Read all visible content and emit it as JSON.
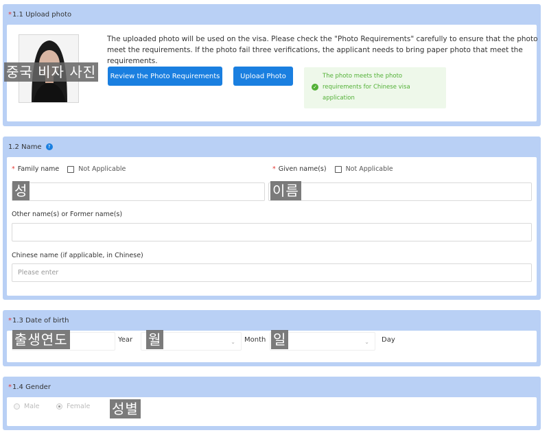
{
  "upload": {
    "number": "1.1 Upload photo",
    "description": "The uploaded photo will be used on the visa. Please check the \"Photo Requirements\" carefully to ensure that the photo meet the requirements. If the photo fail three verifications, the applicant needs to bring paper photo that meet the requirements.",
    "view_button": "Review the Photo Requirements",
    "upload_button": "Upload Photo",
    "status_text": "The photo meets the photo requirements for Chinese visa application",
    "overlay": "중국 비자 사진"
  },
  "name": {
    "title": "1.2 Name",
    "family_label": "Family name",
    "given_label": "Given name(s)",
    "not_applicable": "Not Applicable",
    "other_label": "Other name(s) or Former name(s)",
    "chinese_label": "Chinese name (if applicable, in Chinese)",
    "chinese_placeholder": "Please enter",
    "overlay_family": "성",
    "overlay_given": "이름"
  },
  "dob": {
    "title": "1.3 Date of birth",
    "year_unit": "Year",
    "month_unit": "Month",
    "day_unit": "Day",
    "overlay_year": "출생연도",
    "overlay_month": "월",
    "overlay_day": "일"
  },
  "gender": {
    "title": "1.4 Gender",
    "options": [
      "Male",
      "Female"
    ],
    "selected": "Female",
    "overlay": "성별"
  },
  "required_mark": "*",
  "colors": {
    "section_bg": "#b9d0f5",
    "primary": "#1a7fe0",
    "success": "#52b036",
    "required": "#e53935"
  }
}
